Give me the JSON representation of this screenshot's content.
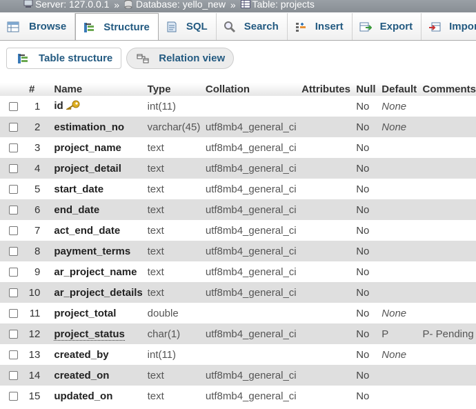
{
  "breadcrumb": {
    "server": "Server: 127.0.0.1",
    "database": "Database: yello_new",
    "table": "Table: projects",
    "separator": "»"
  },
  "tabs": [
    {
      "label": "Browse",
      "icon": "browse-icon"
    },
    {
      "label": "Structure",
      "icon": "structure-icon",
      "active": true
    },
    {
      "label": "SQL",
      "icon": "sql-icon"
    },
    {
      "label": "Search",
      "icon": "search-icon"
    },
    {
      "label": "Insert",
      "icon": "insert-icon"
    },
    {
      "label": "Export",
      "icon": "export-icon"
    },
    {
      "label": "Import",
      "icon": "import-icon"
    }
  ],
  "subtabs": [
    {
      "label": "Table structure",
      "icon": "table-structure-icon"
    },
    {
      "label": "Relation view",
      "icon": "relation-view-icon"
    }
  ],
  "table": {
    "headers": {
      "num": "#",
      "name": "Name",
      "type": "Type",
      "collation": "Collation",
      "attributes": "Attributes",
      "null": "Null",
      "default": "Default",
      "comments": "Comments"
    },
    "rows": [
      {
        "num": "1",
        "name": "id",
        "type": "int(11)",
        "collation": "",
        "null": "No",
        "default": "None",
        "comment": "",
        "primary_key": true
      },
      {
        "num": "2",
        "name": "estimation_no",
        "type": "varchar(45)",
        "collation": "utf8mb4_general_ci",
        "null": "No",
        "default": "None",
        "comment": ""
      },
      {
        "num": "3",
        "name": "project_name",
        "type": "text",
        "collation": "utf8mb4_general_ci",
        "null": "No",
        "default": "",
        "comment": ""
      },
      {
        "num": "4",
        "name": "project_detail",
        "type": "text",
        "collation": "utf8mb4_general_ci",
        "null": "No",
        "default": "",
        "comment": ""
      },
      {
        "num": "5",
        "name": "start_date",
        "type": "text",
        "collation": "utf8mb4_general_ci",
        "null": "No",
        "default": "",
        "comment": ""
      },
      {
        "num": "6",
        "name": "end_date",
        "type": "text",
        "collation": "utf8mb4_general_ci",
        "null": "No",
        "default": "",
        "comment": ""
      },
      {
        "num": "7",
        "name": "act_end_date",
        "type": "text",
        "collation": "utf8mb4_general_ci",
        "null": "No",
        "default": "",
        "comment": ""
      },
      {
        "num": "8",
        "name": "payment_terms",
        "type": "text",
        "collation": "utf8mb4_general_ci",
        "null": "No",
        "default": "",
        "comment": ""
      },
      {
        "num": "9",
        "name": "ar_project_name",
        "type": "text",
        "collation": "utf8mb4_general_ci",
        "null": "No",
        "default": "",
        "comment": ""
      },
      {
        "num": "10",
        "name": "ar_project_details",
        "type": "text",
        "collation": "utf8mb4_general_ci",
        "null": "No",
        "default": "",
        "comment": ""
      },
      {
        "num": "11",
        "name": "project_total",
        "type": "double",
        "collation": "",
        "null": "No",
        "default": "None",
        "comment": ""
      },
      {
        "num": "12",
        "name": "project_status",
        "type": "char(1)",
        "collation": "utf8mb4_general_ci",
        "null": "No",
        "default": "P",
        "comment": "P- Pending",
        "has_comment_underline": true
      },
      {
        "num": "13",
        "name": "created_by",
        "type": "int(11)",
        "collation": "",
        "null": "No",
        "default": "None",
        "comment": ""
      },
      {
        "num": "14",
        "name": "created_on",
        "type": "text",
        "collation": "utf8mb4_general_ci",
        "null": "No",
        "default": "",
        "comment": ""
      },
      {
        "num": "15",
        "name": "updated_on",
        "type": "text",
        "collation": "utf8mb4_general_ci",
        "null": "No",
        "default": "",
        "comment": ""
      }
    ]
  },
  "colors": {
    "link": "#235a81",
    "row_alt": "#dfdfdf",
    "breadcrumb_bg": "#8f959b",
    "key_icon": "#e0b020"
  }
}
